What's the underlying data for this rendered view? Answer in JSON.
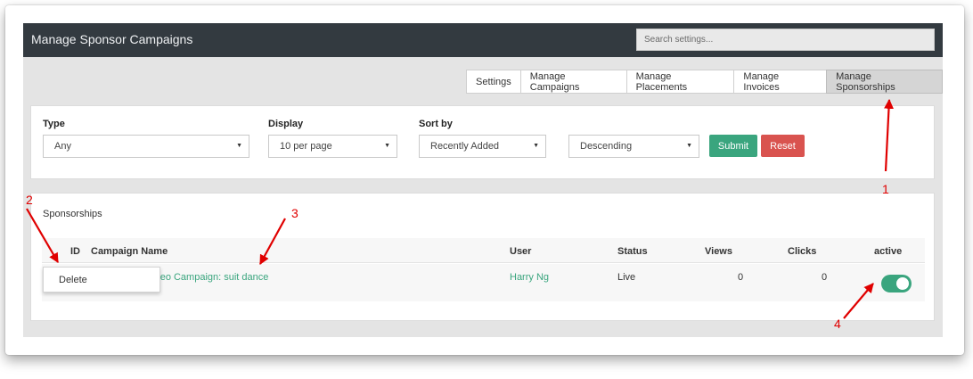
{
  "header": {
    "title": "Manage Sponsor Campaigns",
    "search_placeholder": "Search settings..."
  },
  "tabs": [
    {
      "label": "Settings"
    },
    {
      "label": "Manage Campaigns"
    },
    {
      "label": "Manage Placements"
    },
    {
      "label": "Manage Invoices"
    },
    {
      "label": "Manage Sponsorships",
      "active": true
    }
  ],
  "filters": {
    "type_label": "Type",
    "type_value": "Any",
    "display_label": "Display",
    "display_value": "10 per page",
    "sort_label": "Sort by",
    "sort_value": "Recently Added",
    "order_value": "Descending",
    "submit_label": "Submit",
    "reset_label": "Reset"
  },
  "sponsorships": {
    "title": "Sponsorships",
    "columns": {
      "id": "ID",
      "campaign": "Campaign Name",
      "user": "User",
      "status": "Status",
      "views": "Views",
      "clicks": "Clicks",
      "active": "active"
    },
    "rows": [
      {
        "campaign": "Video Campaign: suit dance",
        "user": "Harry Ng",
        "status": "Live",
        "views": "0",
        "clicks": "0",
        "active": true
      }
    ],
    "context_menu": {
      "delete_label": "Delete"
    }
  },
  "annotations": {
    "labels": [
      "1",
      "2",
      "3",
      "4"
    ],
    "color": "#e00000"
  },
  "colors": {
    "header_bg": "#333a40",
    "accent_green": "#3aa57e",
    "reset_red": "#d9534f",
    "page_bg": "#e4e4e4"
  }
}
